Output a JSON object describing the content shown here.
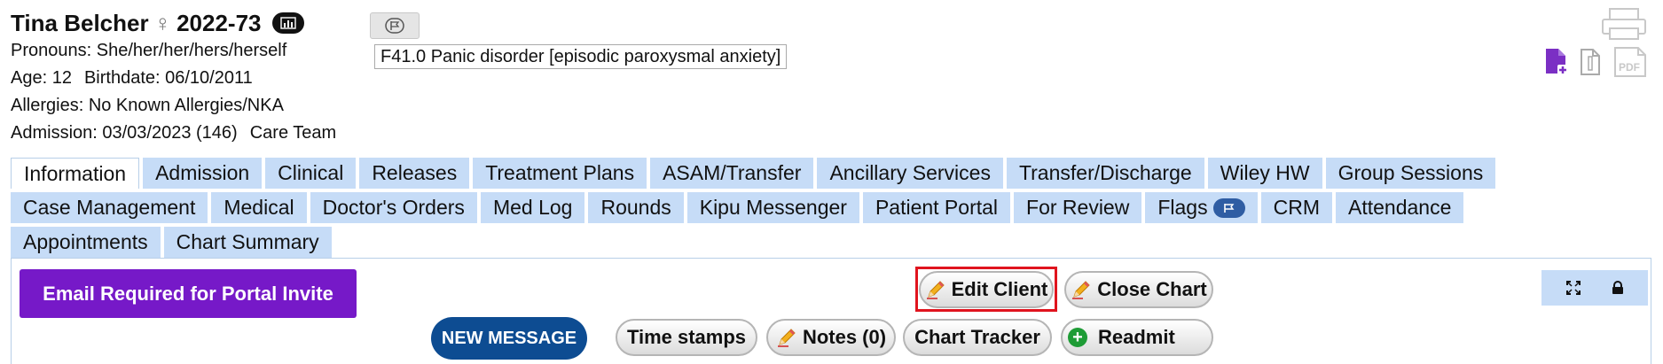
{
  "patient": {
    "name": "Tina Belcher",
    "gender_symbol": "♀",
    "id": "2022-73",
    "pronouns": "Pronouns: She/her/her/hers/herself",
    "age": "Age: 12",
    "birthdate": "Birthdate: 06/10/2011",
    "allergies": "Allergies: No Known Allergies/NKA",
    "admission": "Admission: 03/03/2023 (146)",
    "care_team": "Care Team"
  },
  "diagnosis": "F41.0 Panic disorder [episodic paroxysmal anxiety]",
  "tabs": {
    "row1": [
      "Information",
      "Admission",
      "Clinical",
      "Releases",
      "Treatment Plans",
      "ASAM/Transfer",
      "Ancillary Services",
      "Transfer/Discharge",
      "Wiley HW",
      "Group Sessions"
    ],
    "row2": [
      "Case Management",
      "Medical",
      "Doctor's Orders",
      "Med Log",
      "Rounds",
      "Kipu Messenger",
      "Patient Portal",
      "For Review",
      "Flags",
      "CRM",
      "Attendance"
    ],
    "row3": [
      "Appointments",
      "Chart Summary"
    ]
  },
  "buttons": {
    "email_required": "Email Required for Portal Invite",
    "new_message": "NEW MESSAGE",
    "edit_client": "Edit Client",
    "close_chart": "Close Chart",
    "time_stamps": "Time stamps",
    "notes": "Notes (0)",
    "chart_tracker": "Chart Tracker",
    "readmit": "Readmit"
  },
  "icons": {
    "printer": "printer-icon",
    "add_document": "add-document-icon",
    "document": "document-icon",
    "pdf": "pdf-icon",
    "expand": "expand-icon",
    "lock": "lock-icon"
  },
  "colors": {
    "tab_bg": "#c6dcf7",
    "email_btn": "#7619c8",
    "new_message_btn": "#0d4c92",
    "highlight": "#e0141e",
    "add_doc_icon": "#7b2fc4"
  }
}
